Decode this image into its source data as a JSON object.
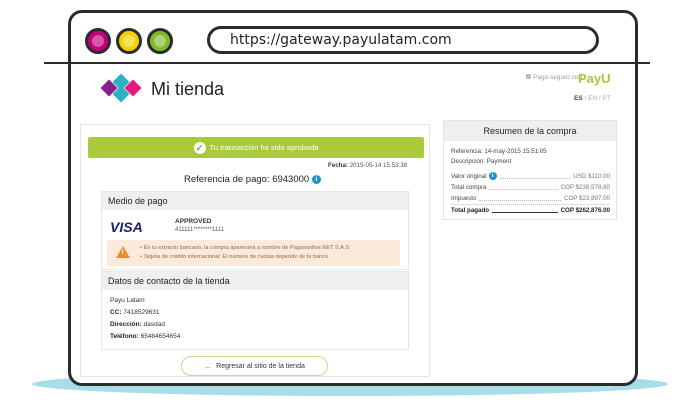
{
  "browser": {
    "url": "https://gateway.payulatam.com",
    "dots": [
      {
        "name": "magenta",
        "color": "#c1007a"
      },
      {
        "name": "yellow",
        "color": "#f2d000"
      },
      {
        "name": "green",
        "color": "#7fba2c"
      }
    ]
  },
  "header": {
    "store_name": "Mi tienda",
    "secure_label": "Pago seguro con",
    "payu_logo": "PayU",
    "languages": {
      "active": "ES",
      "others": "/ EN / PT"
    }
  },
  "transaction": {
    "banner": "Tu transacción ha sido aprobada",
    "date_label": "Fecha:",
    "date_value": "2015-05-14  15:53:38",
    "reference_label": "Referencia de pago:",
    "reference_value": "6943000"
  },
  "payment": {
    "heading": "Medio de pago",
    "card_brand": "VISA",
    "status": "APPROVED",
    "card_number": "411111********1111",
    "alert_lines": [
      "• En tu extracto bancario, la compra aparecerá a nombre de Pagosonline.NET S.A.S",
      "• Tarjeta de crédito internacional: El número de cuotas depende de tu banco"
    ]
  },
  "contact": {
    "heading": "Datos de contacto de la tienda",
    "name": "Payu Latam",
    "cc_label": "CC:",
    "cc_value": "7418529631",
    "address_label": "Dirección:",
    "address_value": "dasdad",
    "phone_label": "Teléfono:",
    "phone_value": "65484654654"
  },
  "back_button": "Regresar al sitio de la tienda",
  "summary": {
    "heading": "Resumen de la compra",
    "reference": "Referencia: 14-may-2015 15:51:05",
    "description": "Descripción: Payment",
    "rows": [
      {
        "label": "Valor original",
        "value": "USD $110.00"
      },
      {
        "label": "Total compra",
        "value": "COP $238,978.80"
      },
      {
        "label": "Impuesto",
        "value": "COP $23,897.00"
      }
    ],
    "total_label": "Total pagado",
    "total_value": "COP $262,876.00"
  },
  "colors": {
    "approved_green": "#a9cb3b",
    "alert_bg": "#fbe9dc",
    "warning_orange": "#e88a2e",
    "visa_blue": "#1a1f71",
    "info_blue": "#1e90c8",
    "shadow": "#a6dde6"
  },
  "icons": [
    "check-icon",
    "info-icon",
    "warning-icon",
    "lock-icon",
    "arrow-left-icon",
    "store-logo"
  ]
}
